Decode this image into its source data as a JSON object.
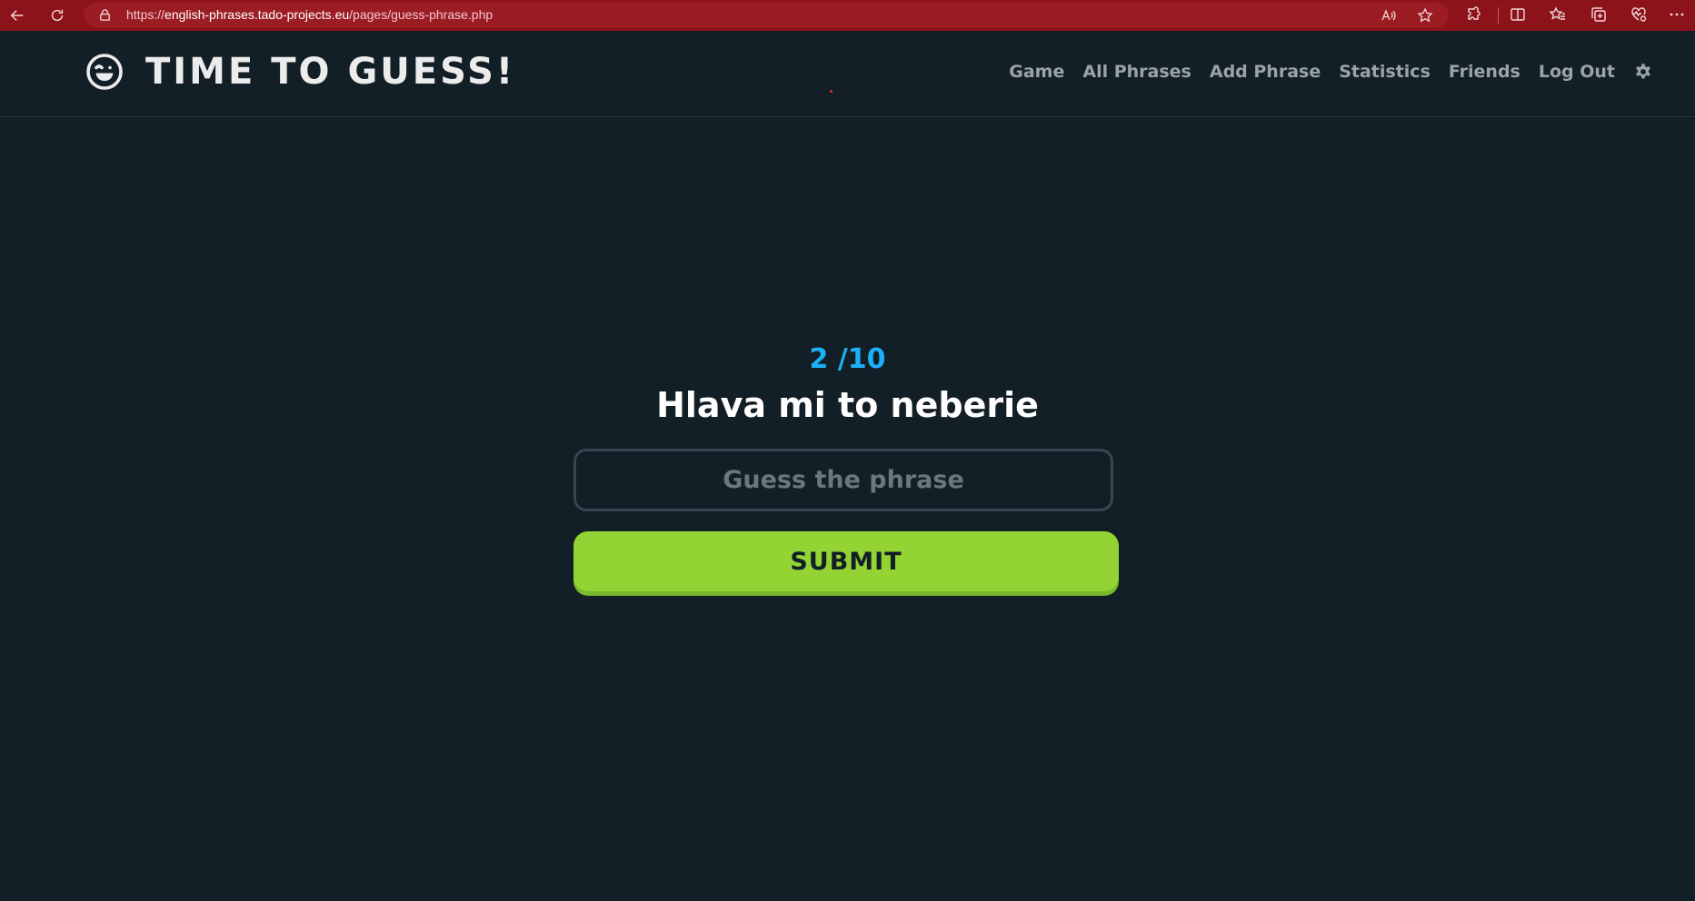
{
  "browser": {
    "url_prefix": "https://",
    "url_host": "english-phrases.tado-projects.eu",
    "url_path": "/pages/guess-phrase.php",
    "accent_color": "#8d131b"
  },
  "header": {
    "logo_text": "TIME TO GUESS!",
    "logo_icon": "winking-face-icon",
    "nav": [
      {
        "label": "Game"
      },
      {
        "label": "All Phrases"
      },
      {
        "label": "Add Phrase"
      },
      {
        "label": "Statistics"
      },
      {
        "label": "Friends"
      },
      {
        "label": "Log Out"
      }
    ],
    "settings_icon": "gear-icon"
  },
  "game": {
    "progress": "2 /10",
    "phrase": "Hlava mi to neberie",
    "input_placeholder": "Guess the phrase",
    "input_value": "",
    "submit_label": "SUBMIT",
    "submit_color": "#93d333",
    "progress_color": "#1cb0f6"
  }
}
